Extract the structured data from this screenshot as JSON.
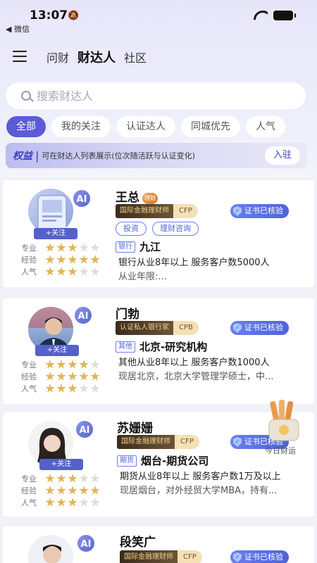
{
  "status": {
    "time": "13:07",
    "back": "◀ 微信"
  },
  "nav": {
    "tabs": [
      {
        "label": "问财"
      },
      {
        "label": "财达人"
      },
      {
        "label": "社区"
      }
    ]
  },
  "search": {
    "placeholder": "搜索财达人"
  },
  "filters": [
    {
      "label": "全部"
    },
    {
      "label": "我的关注"
    },
    {
      "label": "认证达人"
    },
    {
      "label": "同城优先"
    },
    {
      "label": "人气"
    }
  ],
  "banner": {
    "title": "权益",
    "text": "可在财达人列表展示(位次随活跃与认证变化)",
    "button": "入驻"
  },
  "rating_labels": [
    "专业",
    "经验",
    "人气"
  ],
  "ai_label": "AI",
  "follow_label": "+关注",
  "verified_label": "证书已核验",
  "cards": [
    {
      "name": "王总",
      "level": "理财",
      "cert": {
        "label": "国际金融理财师",
        "code": "CFP"
      },
      "tags": [
        "投资",
        "理财咨询"
      ],
      "org_tag": "银行",
      "org": "九江",
      "desc": "银行从业8年以上  服务客户数5000人",
      "desc2": "从业年限:...",
      "ratings": [
        3,
        5,
        3
      ]
    },
    {
      "name": "门勃",
      "cert": {
        "label": "认证私人银行家",
        "code": "CPB"
      },
      "org_tag": "其他",
      "org": "北京-研究机构",
      "desc": "其他从业8年以上  服务客户数1000人",
      "desc2": "现居北京，北京大学管理学硕士，中...",
      "ratings": [
        4,
        5,
        3
      ]
    },
    {
      "name": "苏姗姗",
      "cert": {
        "label": "国际金融理财师",
        "code": "CFP"
      },
      "org_tag": "期货",
      "org": "烟台-期货公司",
      "desc": "期货从业8年以上  服务客户数1万及以上",
      "desc2": "现居烟台，对外经贸大学MBA，持有...",
      "ratings": [
        3,
        5,
        3
      ]
    },
    {
      "name": "段笑广",
      "cert": {
        "label": "国际金融理财师",
        "code": "CFP"
      }
    }
  ],
  "floating": {
    "label": "今日财运"
  },
  "colors": {
    "accent": "#5b5bd6",
    "gold": "#e0b55a",
    "verified": "#4e63d8"
  }
}
